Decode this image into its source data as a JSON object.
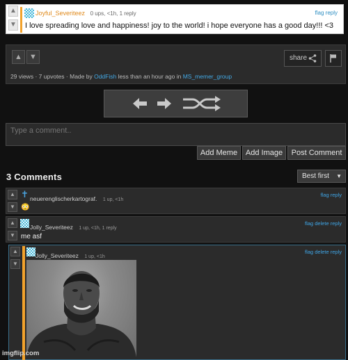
{
  "parent_comment": {
    "username": "Joyful_Severiteez",
    "meta": "0 ups, <1h, 1 reply",
    "flag_label": "flag",
    "reply_label": "reply",
    "text": "I love spreading love and happiness! joy to the world! i hope everyone has a good day!!! <3"
  },
  "post": {
    "share_label": "share",
    "stats": {
      "views": "29 views",
      "upvotes": "7 upvotes",
      "made_by_prefix": "Made by",
      "author": "OddFish",
      "time_text": "less than an hour ago in",
      "stream": "MS_memer_group"
    }
  },
  "comment_form": {
    "placeholder": "Type a comment..",
    "add_meme": "Add Meme",
    "add_image": "Add Image",
    "post_comment": "Post Comment"
  },
  "comments_header": {
    "title": "3 Comments",
    "sort": "Best first"
  },
  "comments": [
    {
      "username": "neuerenglischerkartograf.",
      "meta": "1 up, <1h",
      "links": [
        "flag",
        "reply"
      ],
      "text": "😳"
    },
    {
      "username": "Jolly_Severiteez",
      "meta": "1 up, <1h, 1 reply",
      "links": [
        "flag",
        "delete",
        "reply"
      ],
      "text": "me asf"
    },
    {
      "username": "Jolly_Severiteez",
      "meta": "1 up, <1h",
      "links": [
        "flag",
        "delete",
        "reply"
      ],
      "image": "grayscale-giga-chad-meme-image"
    }
  ],
  "watermark": "imgflip.com",
  "colors": {
    "background": "#111111",
    "panel": "#2b2b2b",
    "link_blue": "#43a8e4",
    "username_orange": "#e08a1c",
    "accent_orange": "#f2a22c"
  }
}
